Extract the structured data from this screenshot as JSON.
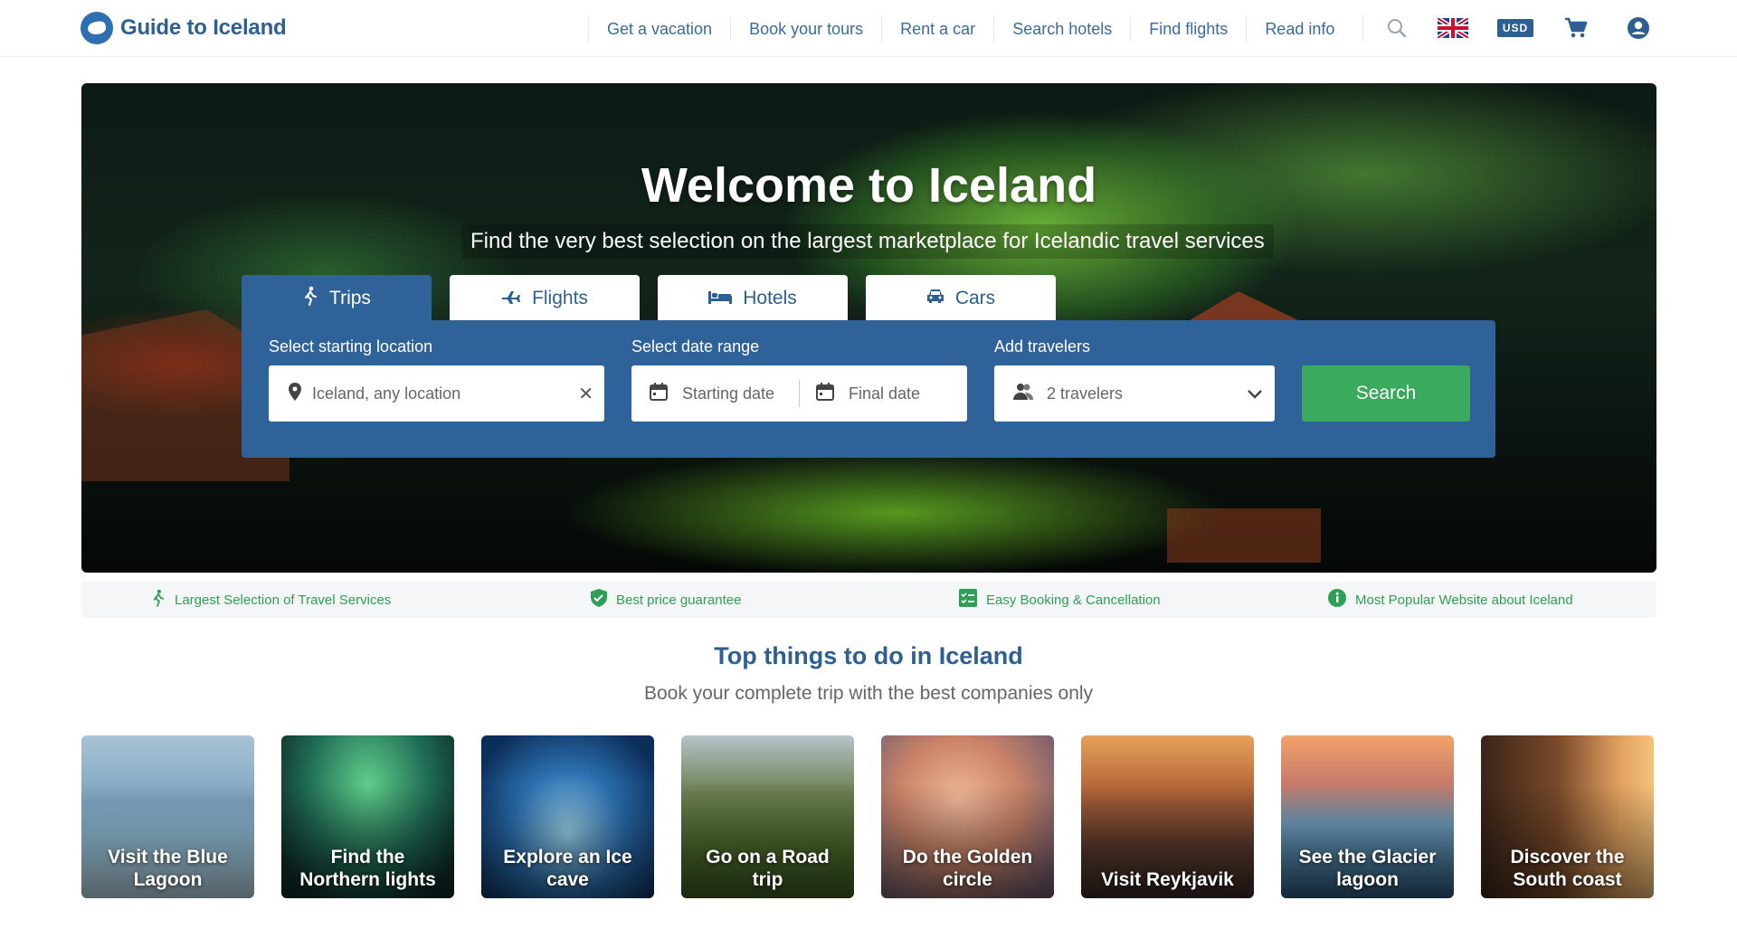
{
  "brand": {
    "name": "Guide to Iceland"
  },
  "nav": {
    "items": [
      "Get a vacation",
      "Book your tours",
      "Rent a car",
      "Search hotels",
      "Find flights",
      "Read info"
    ],
    "currency": "USD",
    "icons": [
      "search-icon",
      "uk-flag-icon",
      "cart-icon",
      "account-icon"
    ]
  },
  "hero": {
    "title": "Welcome to Iceland",
    "subtitle": "Find the very best selection on the largest marketplace for Icelandic travel services",
    "tabs": [
      {
        "label": "Trips",
        "icon": "hiker-icon",
        "active": true
      },
      {
        "label": "Flights",
        "icon": "plane-icon",
        "active": false
      },
      {
        "label": "Hotels",
        "icon": "bed-icon",
        "active": false
      },
      {
        "label": "Cars",
        "icon": "car-icon",
        "active": false
      }
    ],
    "form": {
      "location_label": "Select starting location",
      "location_value": "Iceland, any location",
      "date_label": "Select date range",
      "start_placeholder": "Starting date",
      "end_placeholder": "Final date",
      "travelers_label": "Add travelers",
      "travelers_value": "2 travelers",
      "search_label": "Search"
    }
  },
  "trust": [
    {
      "label": "Largest Selection of Travel Services",
      "icon": "hiker-icon"
    },
    {
      "label": "Best price guarantee",
      "icon": "shield-check-icon"
    },
    {
      "label": "Easy Booking & Cancellation",
      "icon": "checklist-icon"
    },
    {
      "label": "Most Popular Website about Iceland",
      "icon": "info-icon"
    }
  ],
  "section": {
    "title": "Top things to do in Iceland",
    "subtitle": "Book your complete trip with the best companies only"
  },
  "cards": [
    {
      "title": "Visit the Blue Lagoon"
    },
    {
      "title": "Find the Northern lights"
    },
    {
      "title": "Explore an Ice cave"
    },
    {
      "title": "Go on a Road trip"
    },
    {
      "title": "Do the Golden circle"
    },
    {
      "title": "Visit Reykjavik"
    },
    {
      "title": "See the Glacier lagoon"
    },
    {
      "title": "Discover the South coast"
    }
  ],
  "colors": {
    "primary": "#2f6299",
    "accent": "#3aaa5c",
    "brand_text": "#2d5f93"
  }
}
